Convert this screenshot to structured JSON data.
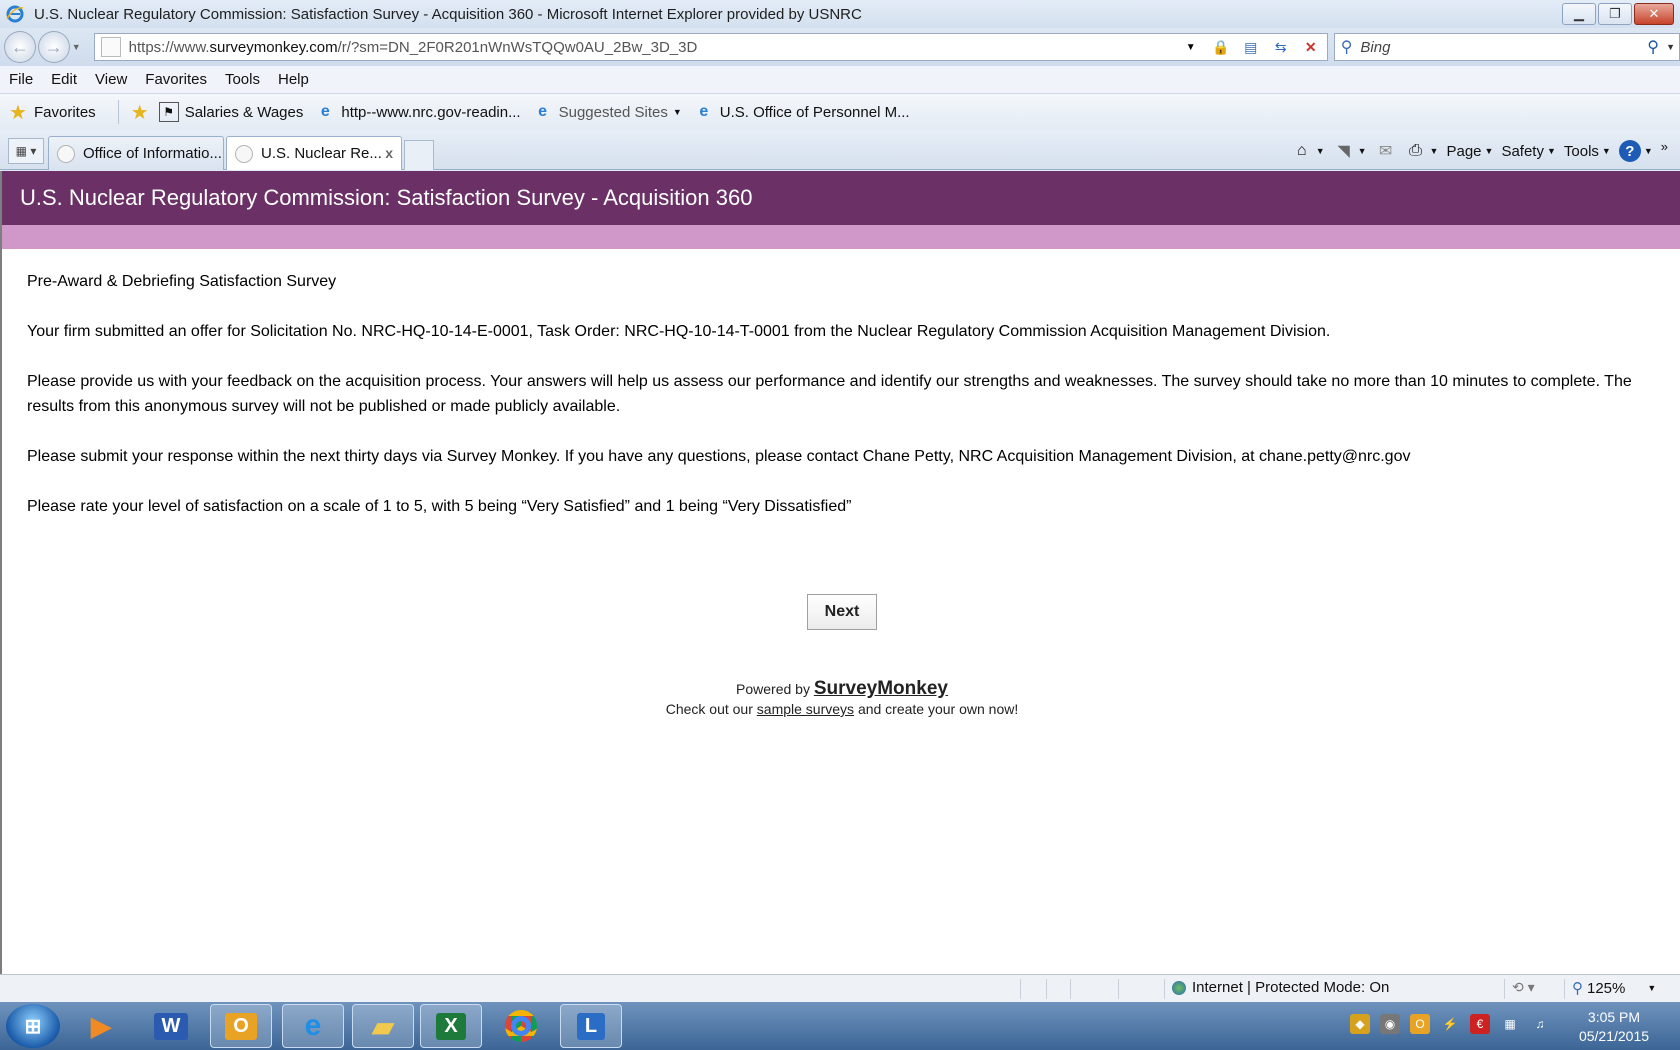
{
  "window": {
    "title": "U.S. Nuclear Regulatory Commission: Satisfaction Survey - Acquisition 360 - Microsoft Internet Explorer provided by USNRC"
  },
  "address": {
    "url_prefix": "https://www.",
    "url_domain": "surveymonkey.com",
    "url_path": "/r/?sm=DN_2F0R201nWnWsTQQw0AU_2Bw_3D_3D",
    "search_placeholder": "Bing"
  },
  "menu": [
    "File",
    "Edit",
    "View",
    "Favorites",
    "Tools",
    "Help"
  ],
  "favorites": {
    "label": "Favorites",
    "items": [
      "Salaries & Wages",
      "http--www.nrc.gov-readin...",
      "Suggested Sites",
      "U.S. Office of Personnel M..."
    ]
  },
  "tabs": [
    {
      "label": "Office of Informatio...",
      "active": false
    },
    {
      "label": "U.S. Nuclear Re...",
      "active": true,
      "close": "x"
    }
  ],
  "commandbar": {
    "page": "Page",
    "safety": "Safety",
    "tools": "Tools",
    "help": "?"
  },
  "survey": {
    "header": "U.S. Nuclear Regulatory Commission: Satisfaction Survey - Acquisition 360",
    "heading": "Pre-Award & Debriefing Satisfaction Survey",
    "p1": "Your firm submitted an offer for Solicitation No. NRC-HQ-10-14-E-0001, Task Order: NRC-HQ-10-14-T-0001 from the Nuclear Regulatory Commission Acquisition Management Division.",
    "p2": "Please provide us with your feedback on the acquisition process. Your answers will help us assess our performance and identify our strengths and weaknesses. The survey should take no more than 10 minutes to complete. The results from this anonymous survey will not be published or made publicly available.",
    "p3": "Please submit your response within the next thirty days via Survey Monkey. If you have any questions, please contact Chane Petty, NRC Acquisition Management Division, at chane.petty@nrc.gov",
    "p4": "Please rate your level of satisfaction on a scale of 1 to 5, with 5 being “Very Satisfied” and 1 being “Very Dissatisfied”",
    "next_label": "Next",
    "powered_prefix": "Powered by",
    "brand": "SurveyMonkey",
    "checkout_prefix": "Check out our",
    "checkout_link": "sample surveys",
    "checkout_suffix": "and create your own now!"
  },
  "status": {
    "zone": "Internet | Protected Mode: On",
    "zoom": "125%"
  },
  "taskbar": {
    "time": "3:05 PM",
    "date": "05/21/2015"
  }
}
